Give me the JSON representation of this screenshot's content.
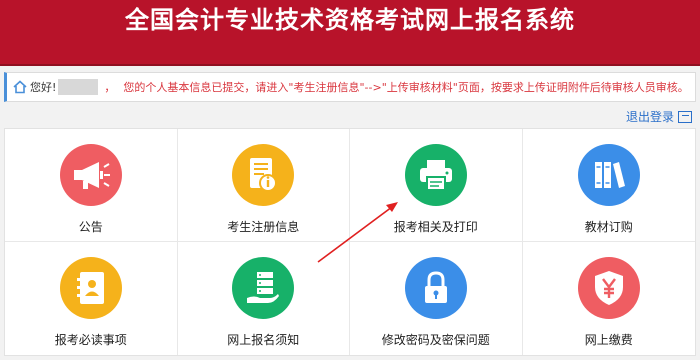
{
  "header": {
    "title": "全国会计专业技术资格考试网上报名系统",
    "color": "#b8132a"
  },
  "notice": {
    "greeting": "您好!",
    "separator": "，",
    "message": "您的个人基本信息已提交，请进入\"考生注册信息\"-->\"上传审核材料\"页面，按要求上传证明附件后待审核人员审核。",
    "message_color": "#d9363e"
  },
  "logout": {
    "label": "退出登录",
    "icon": "logout-icon"
  },
  "tiles": [
    {
      "label": "公告",
      "icon": "megaphone-icon",
      "color": "#ef5d62"
    },
    {
      "label": "考生注册信息",
      "icon": "info-document-icon",
      "color": "#f5b21b"
    },
    {
      "label": "报考相关及打印",
      "icon": "printer-icon",
      "color": "#17b169"
    },
    {
      "label": "教材订购",
      "icon": "books-icon",
      "color": "#3b8ee8"
    },
    {
      "label": "报考必读事项",
      "icon": "contact-book-icon",
      "color": "#f5b21b"
    },
    {
      "label": "网上报名须知",
      "icon": "hand-server-icon",
      "color": "#17b169"
    },
    {
      "label": "修改密码及密保问题",
      "icon": "lock-icon",
      "color": "#3b8ee8"
    },
    {
      "label": "网上缴费",
      "icon": "yen-shield-icon",
      "color": "#ef5d62"
    }
  ],
  "annotation": {
    "type": "red-arrow",
    "target": "报考相关及打印",
    "color": "#e02020"
  }
}
